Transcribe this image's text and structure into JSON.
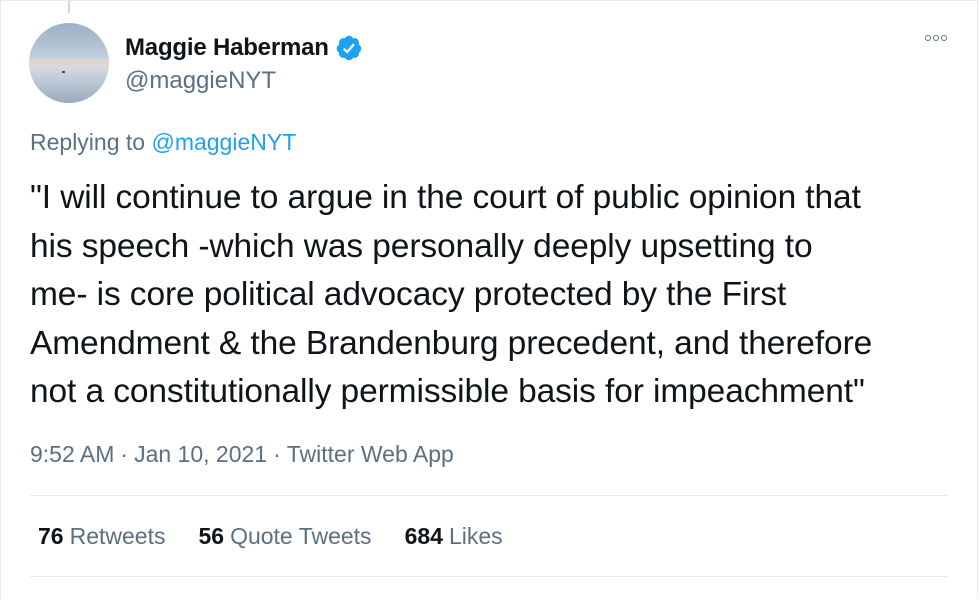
{
  "author": {
    "display_name": "Maggie Haberman",
    "handle": "@maggieNYT",
    "verified": true
  },
  "replying": {
    "prefix": "Replying to",
    "handle": "@maggieNYT"
  },
  "tweet": {
    "text": "\"I will continue to argue in the court of public opinion that\nhis speech -which was personally deeply upsetting to\nme- is core political advocacy protected by the First\nAmendment & the Brandenburg precedent, and therefore\nnot a constitutionally permissible basis for impeachment\""
  },
  "meta": {
    "time": "9:52 AM",
    "date": "Jan 10, 2021",
    "source": "Twitter Web App",
    "separator": "·"
  },
  "stats": {
    "retweets": {
      "count": "76",
      "label": "Retweets"
    },
    "quotes": {
      "count": "56",
      "label": "Quote Tweets"
    },
    "likes": {
      "count": "684",
      "label": "Likes"
    }
  },
  "colors": {
    "accent": "#1da1f2",
    "muted": "#5b7083",
    "text": "#0f1419",
    "border": "#e6ecf0"
  },
  "icons": [
    "verified-badge-icon",
    "more-options-icon"
  ]
}
